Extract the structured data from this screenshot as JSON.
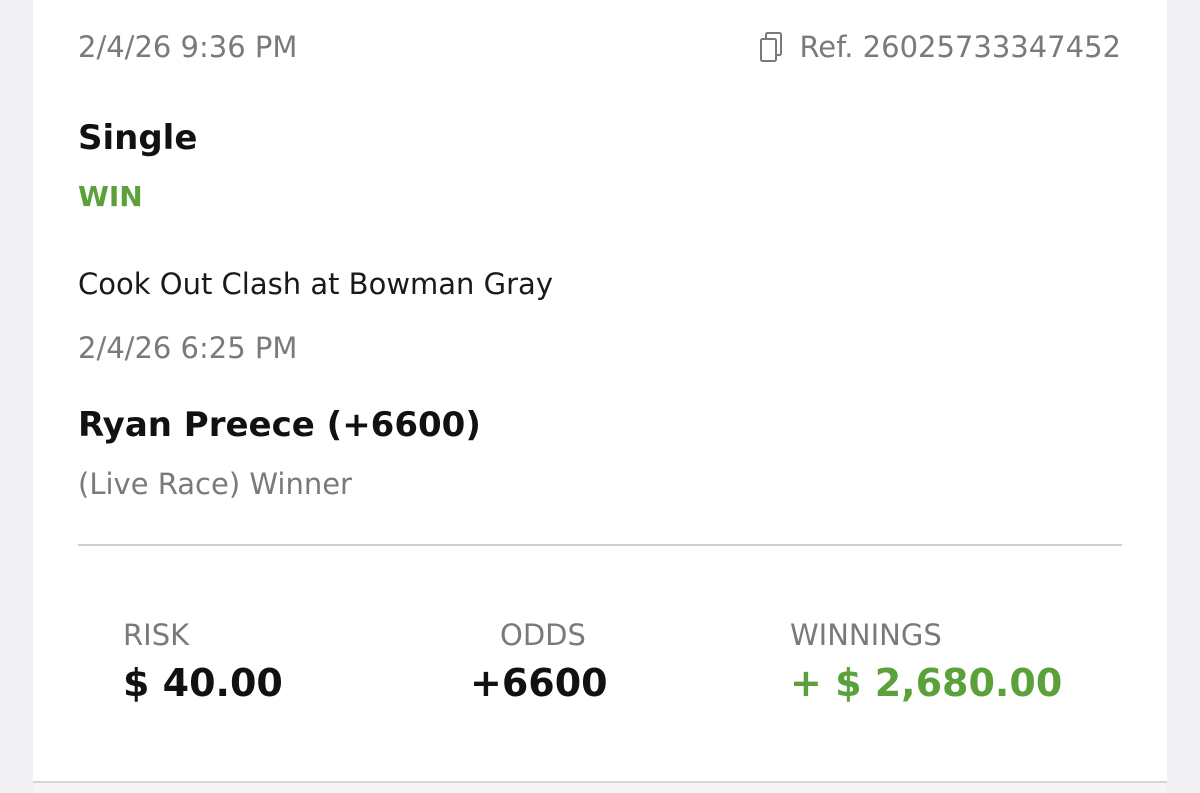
{
  "bet": {
    "placed_at": "2/4/26 9:36 PM",
    "reference": "Ref. 26025733347452",
    "type": "Single",
    "result": "WIN",
    "event_name": "Cook Out Clash at Bowman Gray",
    "event_date": "2/4/26 6:25 PM",
    "selection": "Ryan Preece (+6600)",
    "market": "(Live Race) Winner"
  },
  "summary": {
    "risk_label": "RISK",
    "risk_value": "$ 40.00",
    "odds_label": "ODDS",
    "odds_value": "+6600",
    "winnings_label": "WINNINGS",
    "winnings_value": "+ $ 2,680.00"
  },
  "icons": {
    "reference": "copy-icon"
  },
  "colors": {
    "win": "#5aa13a",
    "muted_text": "#7a7a7a",
    "primary_text": "#111111",
    "background": "#efeff4",
    "card": "#ffffff"
  }
}
